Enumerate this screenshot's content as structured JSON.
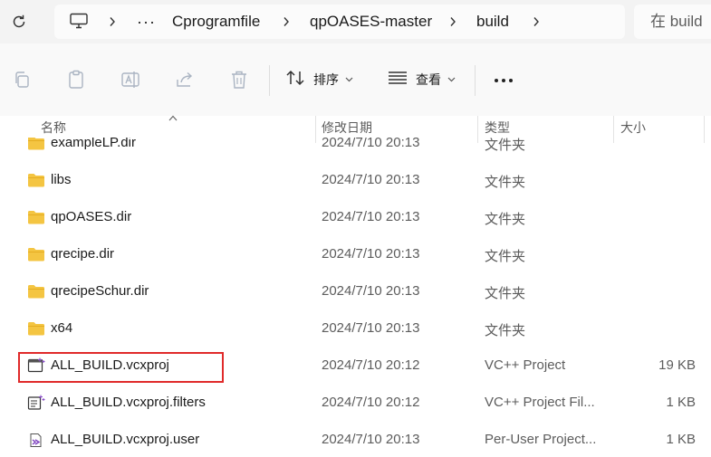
{
  "address_bar": {
    "breadcrumbs": [
      "Cprogramfile",
      "qpOASES-master",
      "build"
    ],
    "more": "···",
    "search_placeholder": "在 build"
  },
  "toolbar": {
    "sort_label": "排序",
    "view_label": "查看",
    "more_label": "···"
  },
  "columns": {
    "name": "名称",
    "date": "修改日期",
    "type": "类型",
    "size": "大小"
  },
  "files": [
    {
      "name": "exampleLP.dir",
      "date": "2024/7/10 20:13",
      "type": "文件夹",
      "size": "",
      "icon": "folder-icon"
    },
    {
      "name": "libs",
      "date": "2024/7/10 20:13",
      "type": "文件夹",
      "size": "",
      "icon": "folder-icon"
    },
    {
      "name": "qpOASES.dir",
      "date": "2024/7/10 20:13",
      "type": "文件夹",
      "size": "",
      "icon": "folder-icon"
    },
    {
      "name": "qrecipe.dir",
      "date": "2024/7/10 20:13",
      "type": "文件夹",
      "size": "",
      "icon": "folder-icon"
    },
    {
      "name": "qrecipeSchur.dir",
      "date": "2024/7/10 20:13",
      "type": "文件夹",
      "size": "",
      "icon": "folder-icon"
    },
    {
      "name": "x64",
      "date": "2024/7/10 20:13",
      "type": "文件夹",
      "size": "",
      "icon": "folder-icon"
    },
    {
      "name": "ALL_BUILD.vcxproj",
      "date": "2024/7/10 20:12",
      "type": "VC++ Project",
      "size": "19 KB",
      "icon": "vcxproj-icon"
    },
    {
      "name": "ALL_BUILD.vcxproj.filters",
      "date": "2024/7/10 20:12",
      "type": "VC++ Project Fil...",
      "size": "1 KB",
      "icon": "vcxproj-filters-icon"
    },
    {
      "name": "ALL_BUILD.vcxproj.user",
      "date": "2024/7/10 20:13",
      "type": "Per-User Project...",
      "size": "1 KB",
      "icon": "vs-user-icon"
    }
  ],
  "highlight_color": "#e02a2a",
  "folder_color": "#f4c542"
}
